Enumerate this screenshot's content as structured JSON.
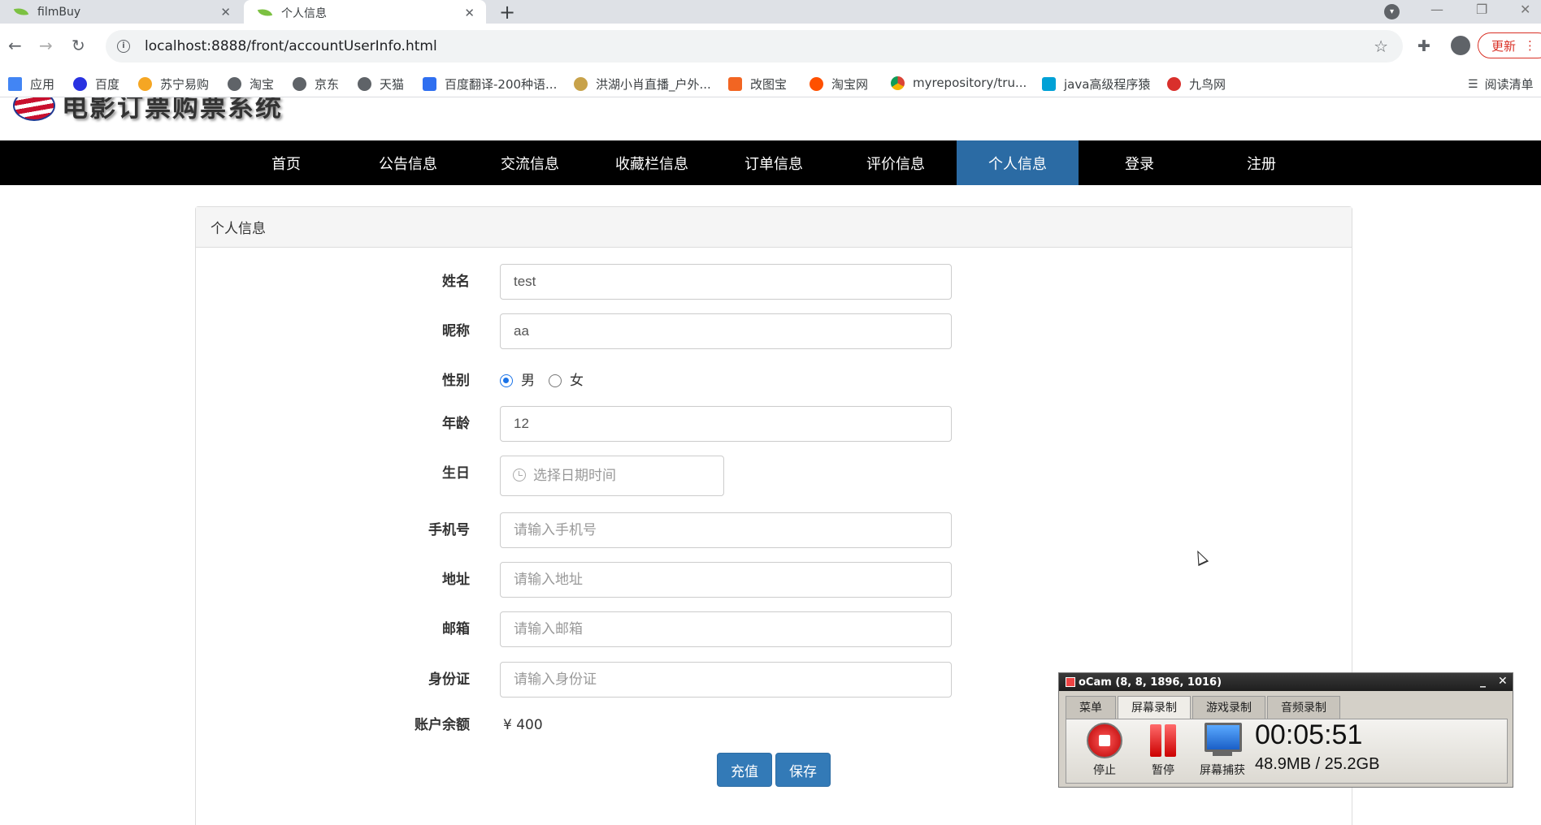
{
  "browser": {
    "tabs": [
      {
        "title": "filmBuy"
      },
      {
        "title": "个人信息"
      }
    ],
    "url": "localhost:8888/front/accountUserInfo.html",
    "update_label": "更新",
    "bookmarks": [
      {
        "label": "应用",
        "icon": "apps-grid-icon"
      },
      {
        "label": "百度",
        "icon": "baidu-icon"
      },
      {
        "label": "苏宁易购",
        "icon": "suning-icon"
      },
      {
        "label": "淘宝",
        "icon": "globe-icon"
      },
      {
        "label": "京东",
        "icon": "globe-icon"
      },
      {
        "label": "天猫",
        "icon": "globe-icon"
      },
      {
        "label": "百度翻译-200种语...",
        "icon": "translate-icon"
      },
      {
        "label": "洪湖小肖直播_户外...",
        "icon": "bird-icon"
      },
      {
        "label": "改图宝",
        "icon": "image-icon"
      },
      {
        "label": "淘宝网",
        "icon": "taobao-icon"
      },
      {
        "label": "myrepository/tru...",
        "icon": "chrome-icon"
      },
      {
        "label": "java高级程序猿",
        "icon": "bilibili-icon"
      },
      {
        "label": "九鸟网",
        "icon": "bird-icon"
      }
    ],
    "reading_list": "阅读清单"
  },
  "site": {
    "logo_text": "电影订票购票系统",
    "nav": [
      "首页",
      "公告信息",
      "交流信息",
      "收藏栏信息",
      "订单信息",
      "评价信息",
      "个人信息",
      "登录",
      "注册"
    ],
    "active_nav": "个人信息"
  },
  "form": {
    "panel_title": "个人信息",
    "name": {
      "label": "姓名",
      "value": "test"
    },
    "nickname": {
      "label": "昵称",
      "value": "aa"
    },
    "gender": {
      "label": "性别",
      "options": [
        "男",
        "女"
      ],
      "selected": "男"
    },
    "age": {
      "label": "年龄",
      "value": "12"
    },
    "birthday": {
      "label": "生日",
      "placeholder": "选择日期时间"
    },
    "phone": {
      "label": "手机号",
      "placeholder": "请输入手机号"
    },
    "address": {
      "label": "地址",
      "placeholder": "请输入地址"
    },
    "email": {
      "label": "邮箱",
      "placeholder": "请输入邮箱"
    },
    "idcard": {
      "label": "身份证",
      "placeholder": "请输入身份证"
    },
    "balance": {
      "label": "账户余额",
      "value": "¥ 400"
    },
    "recharge_label": "充值",
    "save_label": "保存"
  },
  "ocam": {
    "title": "oCam (8, 8, 1896, 1016)",
    "tabs": [
      "菜单",
      "屏幕录制",
      "游戏录制",
      "音频录制"
    ],
    "active_tab": "屏幕录制",
    "stop_label": "停止",
    "pause_label": "暂停",
    "capture_label": "屏幕捕获",
    "elapsed": "00:05:51",
    "size": "48.9MB / 25.2GB"
  }
}
